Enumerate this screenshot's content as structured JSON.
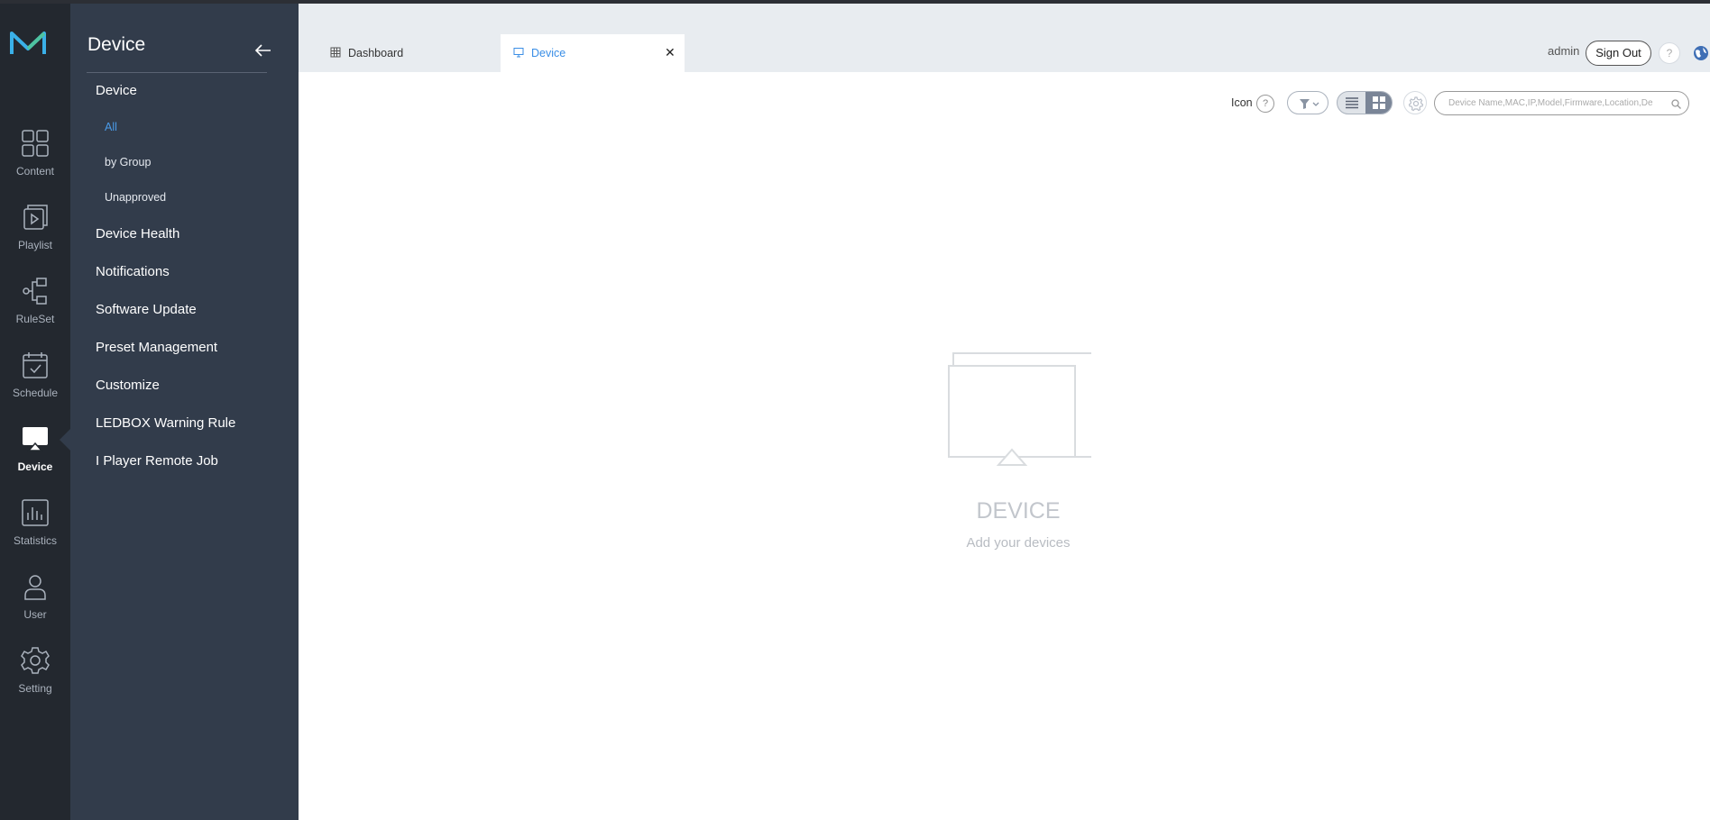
{
  "rail": {
    "items": [
      {
        "label": "Content",
        "icon": "content-grid-icon"
      },
      {
        "label": "Playlist",
        "icon": "playlist-icon"
      },
      {
        "label": "RuleSet",
        "icon": "ruleset-icon"
      },
      {
        "label": "Schedule",
        "icon": "schedule-calendar-icon"
      },
      {
        "label": "Device",
        "icon": "device-monitor-icon",
        "active": true
      },
      {
        "label": "Statistics",
        "icon": "statistics-chart-icon"
      },
      {
        "label": "User",
        "icon": "user-icon"
      },
      {
        "label": "Setting",
        "icon": "gear-icon"
      }
    ]
  },
  "submenu": {
    "title": "Device",
    "items": {
      "device": "Device",
      "all": "All",
      "by_group": "by Group",
      "unapproved": "Unapproved",
      "device_health": "Device Health",
      "notifications": "Notifications",
      "software_update": "Software Update",
      "preset_management": "Preset Management",
      "customize": "Customize",
      "ledbox_warning_rule": "LEDBOX Warning Rule",
      "i_player_remote_job": "I Player Remote Job"
    }
  },
  "tabs": {
    "dashboard": "Dashboard",
    "device": "Device",
    "close": "✕"
  },
  "header": {
    "user": "admin",
    "sign_out": "Sign Out",
    "help": "?"
  },
  "toolbar": {
    "view_label": "Icon",
    "view_help": "?",
    "search_placeholder": "Device Name,MAC,IP,Model,Firmware,Location,De"
  },
  "empty_state": {
    "title": "DEVICE",
    "subtitle": "Add your devices"
  },
  "colors": {
    "rail_bg": "#23282f",
    "submenu_bg": "#323c4b",
    "accent": "#3a8ee6",
    "tabbar_bg": "#e8ecf0"
  }
}
